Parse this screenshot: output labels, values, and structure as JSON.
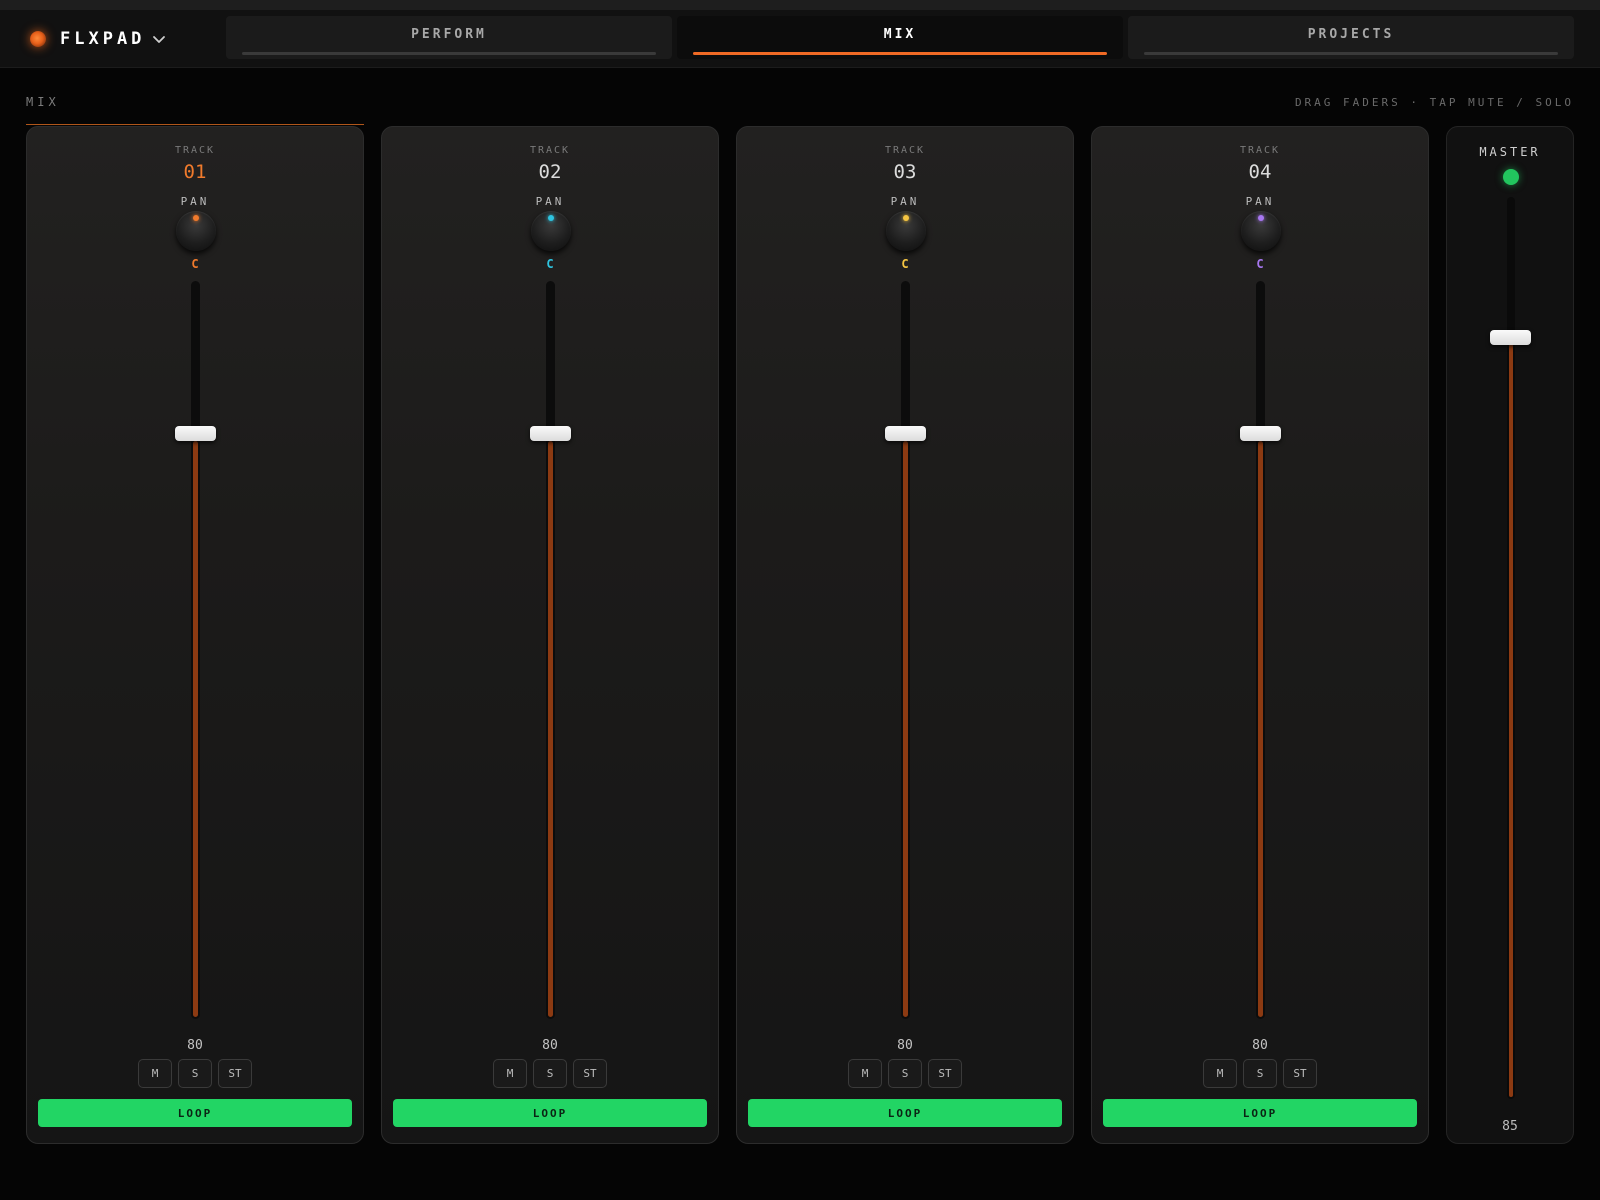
{
  "app": {
    "name": "FLXPAD",
    "logo_icon": "orange-led-dot",
    "menu_icon": "chevron-down-icon"
  },
  "tabs": [
    {
      "label": "PERFORM",
      "active": false
    },
    {
      "label": "MIX",
      "active": true
    },
    {
      "label": "PROJECTS",
      "active": false
    }
  ],
  "section": {
    "title": "MIX",
    "hint": "DRAG FADERS  ·  TAP MUTE / SOLO"
  },
  "colors": {
    "accent": "#f06a25",
    "fader_fill": "#8c3a12",
    "loop": "#22d564",
    "master_led": "#22c55e"
  },
  "tracks": [
    {
      "label": "TRACK",
      "number": "01",
      "selected": true,
      "pan_label": "PAN",
      "pan": "C",
      "color": "#f07a2c",
      "volume": 80,
      "level": 0.8,
      "buttons": [
        "M",
        "S",
        "ST"
      ],
      "loop": "LOOP"
    },
    {
      "label": "TRACK",
      "number": "02",
      "selected": false,
      "pan_label": "PAN",
      "pan": "C",
      "color": "#2ec4e0",
      "volume": 80,
      "level": 0.8,
      "buttons": [
        "M",
        "S",
        "ST"
      ],
      "loop": "LOOP"
    },
    {
      "label": "TRACK",
      "number": "03",
      "selected": false,
      "pan_label": "PAN",
      "pan": "C",
      "color": "#f5c542",
      "volume": 80,
      "level": 0.8,
      "buttons": [
        "M",
        "S",
        "ST"
      ],
      "loop": "LOOP"
    },
    {
      "label": "TRACK",
      "number": "04",
      "selected": false,
      "pan_label": "PAN",
      "pan": "C",
      "color": "#a777f0",
      "volume": 80,
      "level": 0.8,
      "buttons": [
        "M",
        "S",
        "ST"
      ],
      "loop": "LOOP"
    }
  ],
  "master": {
    "label": "MASTER",
    "volume": 85,
    "level": 0.85
  }
}
